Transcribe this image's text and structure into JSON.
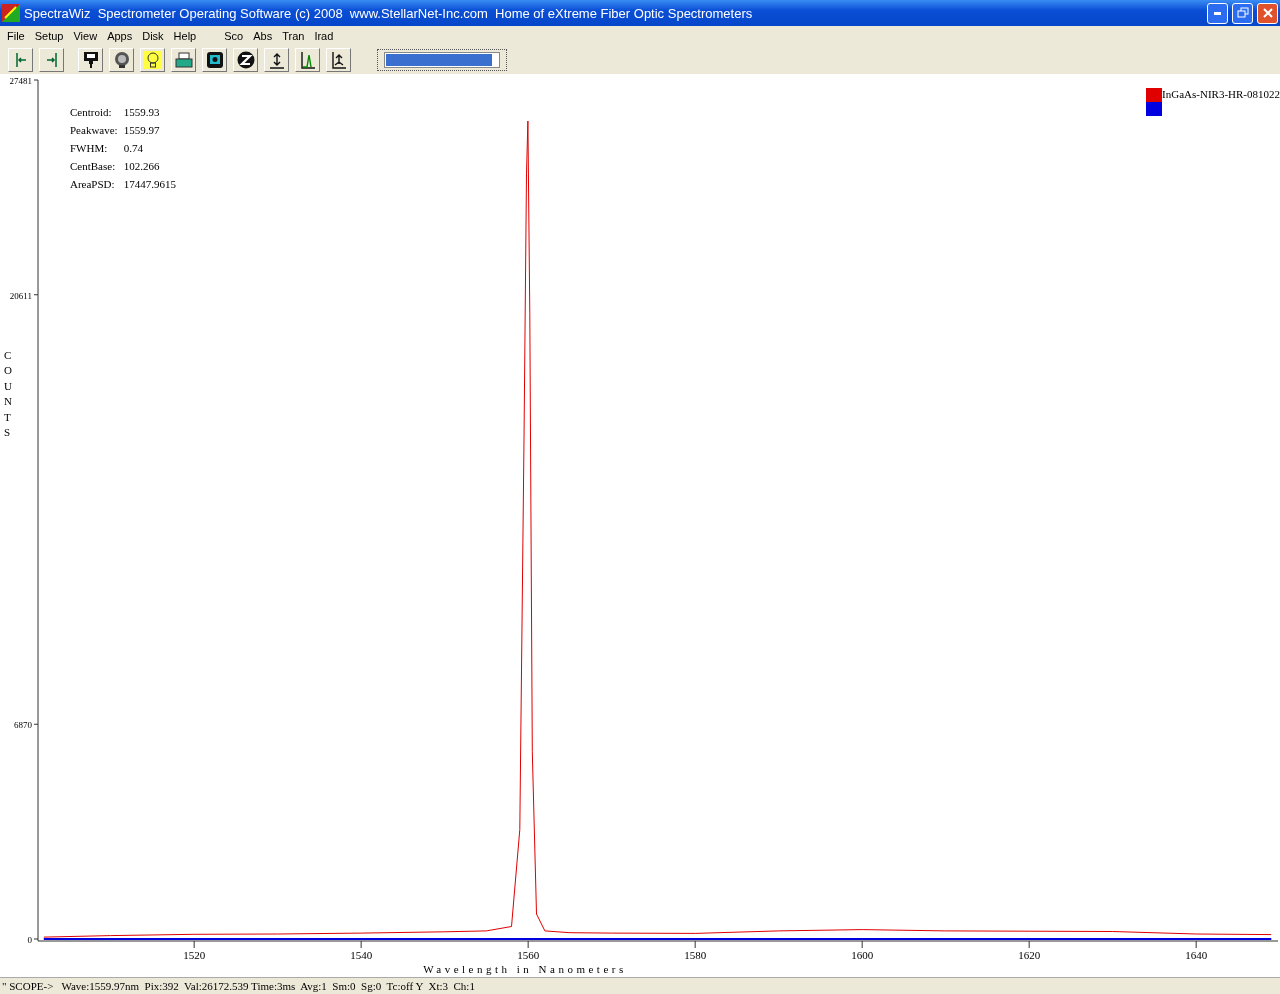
{
  "window": {
    "title": "SpectraWiz  Spectrometer Operating Software (c) 2008  www.StellarNet-Inc.com  Home of eXtreme Fiber Optic Spectrometers"
  },
  "menu_groups": [
    [
      "File",
      "Setup",
      "View",
      "Apps",
      "Disk",
      "Help"
    ],
    [
      "Sco",
      "Abs",
      "Tran",
      "Irad"
    ]
  ],
  "toolbar_groups": [
    [
      {
        "kind": "left-bar"
      },
      {
        "kind": "right-bar"
      }
    ],
    [
      {
        "kind": "stamp"
      },
      {
        "kind": "lamp-dark"
      },
      {
        "kind": "bulb"
      },
      {
        "kind": "printer"
      },
      {
        "kind": "monitor"
      },
      {
        "kind": "z"
      },
      {
        "kind": "updown"
      },
      {
        "kind": "peak"
      },
      {
        "kind": "uparrow"
      }
    ]
  ],
  "progress": {
    "level": 0.95
  },
  "stats": [
    {
      "label": "Centroid:",
      "value": "1559.93"
    },
    {
      "label": "Peakwave:",
      "value": "1559.97"
    },
    {
      "label": "FWHM:",
      "value": "0.74"
    },
    {
      "label": "CentBase:",
      "value": "102.266"
    },
    {
      "label": "AreaPSD:",
      "value": "17447.9615"
    }
  ],
  "chart_data": {
    "type": "line",
    "xlabel": "Wavelength in Nanometers",
    "ylabel": "COUNTS",
    "xlim": [
      1501.3,
      1649.8
    ],
    "ylim": [
      0,
      27481
    ],
    "xticks": [
      1520,
      1540,
      1560,
      1580,
      1600,
      1620,
      1640
    ],
    "yticks": [
      0,
      6870,
      20611,
      27481
    ],
    "x": [
      1502,
      1510,
      1520,
      1530,
      1540,
      1550,
      1555,
      1558,
      1559,
      1559.5,
      1559.8,
      1559.97,
      1560.2,
      1560.5,
      1561,
      1562,
      1565,
      1570,
      1580,
      1590,
      1600,
      1610,
      1620,
      1630,
      1640,
      1649
    ],
    "series": [
      {
        "name": "InGaAs-NIR3-HR-081022",
        "color": "#e00000",
        "values": [
          60,
          110,
          150,
          160,
          190,
          230,
          260,
          400,
          3500,
          16000,
          24500,
          26170,
          20000,
          6000,
          800,
          260,
          200,
          190,
          180,
          260,
          300,
          260,
          250,
          240,
          160,
          140
        ]
      },
      {
        "color": "#0000e0",
        "values": [
          0,
          0,
          0,
          0,
          0,
          0,
          0,
          0,
          0,
          0,
          0,
          0,
          0,
          0,
          0,
          0,
          0,
          0,
          0,
          0,
          0,
          0,
          0,
          0,
          0,
          0
        ]
      }
    ]
  },
  "status_bar": "\" SCOPE->   Wave:1559.97nm  Pix:392  Val:26172.539 Time:3ms  Avg:1  Sm:0  Sg:0  Tc:off Y  Xt:3  Ch:1"
}
